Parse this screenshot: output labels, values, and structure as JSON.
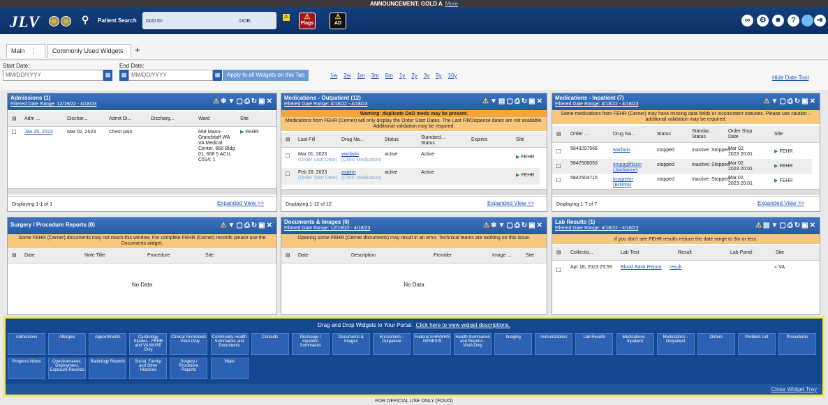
{
  "announcement": {
    "label": "ANNOUNCEMENT: GOLD A",
    "more": "More"
  },
  "header": {
    "logo": "JLV",
    "patient_search": "Patient Search",
    "dod_label": "DoD ID:",
    "dob_label": "DOB:",
    "flags": "Flags",
    "ad": "AD"
  },
  "tabs": {
    "main": "Main",
    "commonly_used": "Commonly Used Widgets",
    "add": "+"
  },
  "dates": {
    "start_label": "Start Date:",
    "end_label": "End Date:",
    "start_ph": "MM/DD/YYYY",
    "end_ph": "MM/DD/YYYY",
    "apply": "Apply to all Widgets on this Tab",
    "quick": [
      "1w",
      "2w",
      "1m",
      "3m",
      "6m",
      "1y",
      "2y",
      "3y",
      "5y",
      "10y"
    ],
    "hide": "Hide Date Tool"
  },
  "admissions": {
    "title": "Admissions (1)",
    "range": "Filtered Date Range: 12/19/22 - 4/18/23",
    "cols": [
      "Adm ...",
      "Dischar...",
      "Admit Di...",
      "Discharg...",
      "Ward",
      "Site"
    ],
    "row": {
      "adm": "Jan 25, 2023",
      "dis": "Mar 02, 2023",
      "dx": "Chest pain",
      "ward": "668 Mann-Grandstaff WA VA Medical Center, 668 Bldg 01, 668 5 ACU, C514; 1",
      "site": "FEHR"
    },
    "footer": "Displaying 1-1 of 1",
    "expanded": "Expanded View >>"
  },
  "med_out": {
    "title": "Medications - Outpatient (12)",
    "range": "Filtered Date Range: 4/18/22 - 4/18/23",
    "warn1": "Warning: duplicate DoD meds may be present.",
    "warn2": "Medications from FEHR (Cerner) will only display the Order Start Dates. The Last Fill/Dispense dates are not available. Additional validation may be required.",
    "cols": [
      "Last Fill",
      "Drug Na...",
      "Status",
      "Standard... Status",
      "Expires",
      "Site"
    ],
    "rows": [
      {
        "date": "Mar 01, 2023",
        "sub": "(Order Start Date)",
        "drug": "warfarin",
        "drugsub": "(Clinic Medication)",
        "status": "active",
        "std": "Active",
        "site": "FEHR"
      },
      {
        "date": "Feb 28, 2023",
        "sub": "(Order Start Date)",
        "drug": "aspirin",
        "drugsub": "(Clinic Medication)",
        "status": "active",
        "std": "Active",
        "site": "FEHR"
      }
    ],
    "footer": "Displaying 1-12 of 12",
    "expanded": "Expanded View >>"
  },
  "med_in": {
    "title": "Medications - Inpatient (7)",
    "range": "Filtered Date Range: 4/18/22 - 4/18/23",
    "warn": "Some medications from FEHR (Cerner) may have missing data fields or inconsistent statuses. Please use caution – additional validation may be required.",
    "cols": [
      "Order ...",
      "Drug Na...",
      "Status",
      "Standar... Status",
      "Order Stop Date",
      "Site"
    ],
    "rows": [
      {
        "order": "5843297565",
        "drug": "warfarin",
        "status": "stopped",
        "std": "Inactive: Stopped",
        "stop": "Mar 02, 2023 20:01",
        "site": "FEHR"
      },
      {
        "order": "5842506053",
        "drug": "empagliflozin (Jardiance)",
        "status": "stopped",
        "std": "Inactive: Stopped",
        "stop": "Mar 02, 2023 20:01",
        "site": "FEHR"
      },
      {
        "order": "5842504715",
        "drug": "ticagrelor (Brilinta)",
        "status": "stopped",
        "std": "Inactive: Stopped",
        "stop": "Mar 02, 2023 20:01",
        "site": "FEHR"
      }
    ],
    "footer": "Displaying 1-7 of 7",
    "expanded": "Expanded View >>"
  },
  "surgery": {
    "title": "Surgery / Procedure Reports (0)",
    "warn": "Some FEHR (Cerner) documents may not reach this window. For complete FEHR (Cerner) records please use the Documents widget.",
    "cols": [
      "Date",
      "Note Title",
      "Procedure",
      "Site"
    ],
    "nodata": "No Data"
  },
  "docs": {
    "title": "Documents & Images (0)",
    "range": "Filtered Date Range: 12/19/22 - 4/18/23",
    "warn": "Opening some FEHR (Cerner documents) may result in an error. Technical teams are working on this issue.",
    "cols": [
      "Date",
      "Description",
      "Provider",
      "Image ...",
      "Site"
    ],
    "nodata": "No Data"
  },
  "labs": {
    "title": "Lab Results (1)",
    "range": "Filtered Date Range: 4/18/22 - 4/18/23",
    "warn": "If you don't see FEHR results reduce the date range to 3m or less.",
    "cols": [
      "Collectio...",
      "Lab Test",
      "Result",
      "Lab Panel",
      "Site"
    ],
    "row": {
      "date": "Apr 18, 2023 23:59",
      "test": "Blood Bank Report",
      "result": "result",
      "site": "VA"
    }
  },
  "tray": {
    "title": "Drag and Drop Widgets to Your Portal.",
    "link": "Click here to view widget descriptions.",
    "row1": [
      "Admissions",
      "Allergies",
      "Appointments",
      "Cardiology Studies - FEHR and VA MUSE Only",
      "Clinical Reminders - VistA Only",
      "Community Health Summaries and Documents",
      "Consults",
      "Discharge / Inpatient Summaries",
      "Documents & Images",
      "Encounters - Outpatient",
      "Federal EHR/MHS GENESIS",
      "Health Summaries and Reports - VistA Only",
      "Imaging",
      "Immunizations",
      "Lab Results",
      "Medications - Inpatient",
      "Medications - Outpatient",
      "Orders",
      "Problem List",
      "Procedures"
    ],
    "row2": [
      "Progress Notes",
      "Questionnaires, Deployment, Exposure Records",
      "Radiology Reports",
      "Social, Family, and Other Histories",
      "Surgery / Procedure Reports",
      "Vitals"
    ],
    "close": "Close Widget Tray"
  },
  "footer": "FOR OFFICIAL USE ONLY (FOUO)"
}
